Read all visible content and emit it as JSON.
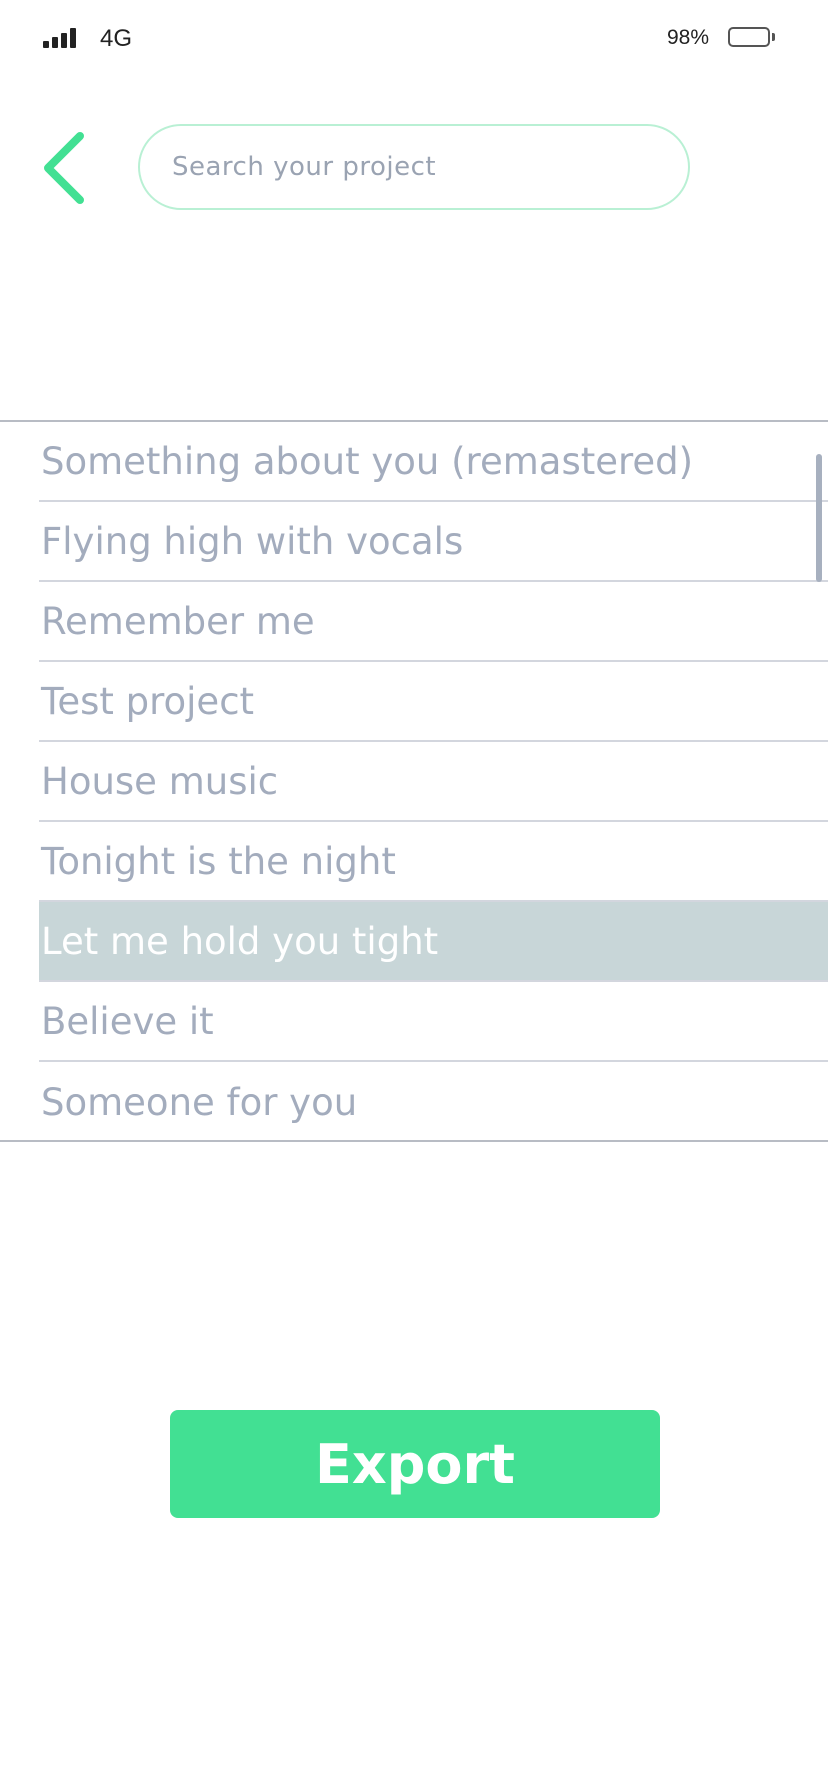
{
  "status_bar": {
    "network": "4G",
    "battery_percent": "98%",
    "battery_level": 0.98
  },
  "header": {
    "back_icon": "chevron-left-icon",
    "search": {
      "placeholder": "Search your project",
      "value": ""
    }
  },
  "projects": {
    "items": [
      {
        "label": "Something about you (remastered)",
        "selected": false
      },
      {
        "label": "Flying high with vocals",
        "selected": false
      },
      {
        "label": "Remember me",
        "selected": false
      },
      {
        "label": "Test project",
        "selected": false
      },
      {
        "label": "House music",
        "selected": false
      },
      {
        "label": "Tonight is the night",
        "selected": false
      },
      {
        "label": "Let me hold you tight",
        "selected": true
      },
      {
        "label": "Believe it",
        "selected": false
      },
      {
        "label": "Someone for you",
        "selected": false
      }
    ]
  },
  "export_button": {
    "label": "Export"
  },
  "colors": {
    "accent": "#42e093",
    "search_border": "#b9f0d4",
    "list_text": "#a3acbd",
    "selected_bg": "#c8d6d8",
    "selected_text": "#ffffff"
  }
}
